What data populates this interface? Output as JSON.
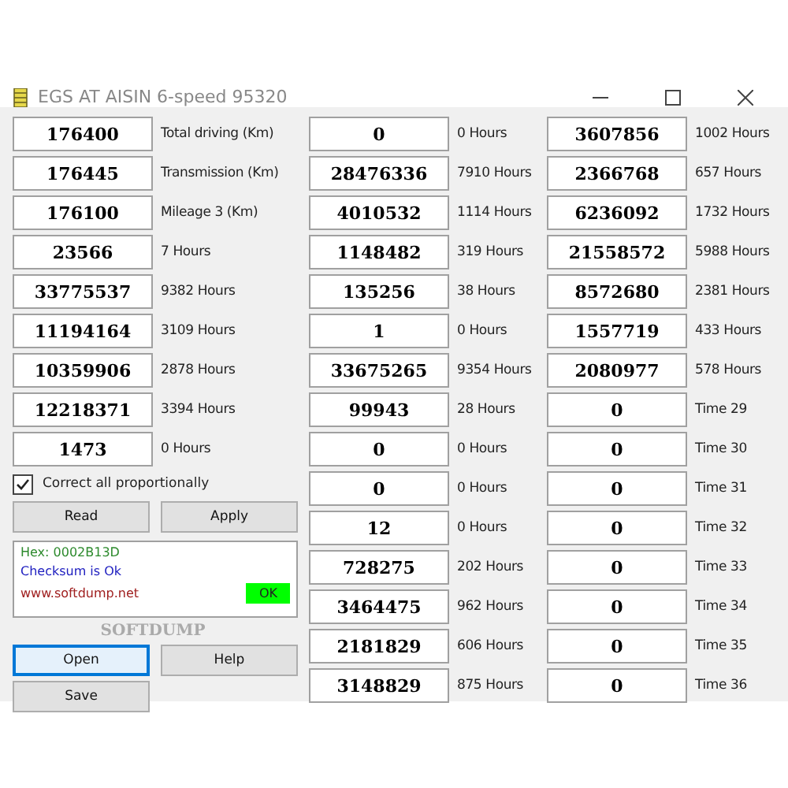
{
  "window": {
    "title": "EGS AT AISIN 6-speed 95320"
  },
  "column_1": [
    {
      "value": "176400",
      "label": "Total driving (Km)"
    },
    {
      "value": "176445",
      "label": "Transmission (Km)"
    },
    {
      "value": "176100",
      "label": "Mileage 3 (Km)"
    },
    {
      "value": "23566",
      "label": "7 Hours"
    },
    {
      "value": "33775537",
      "label": "9382 Hours"
    },
    {
      "value": "11194164",
      "label": "3109 Hours"
    },
    {
      "value": "10359906",
      "label": "2878 Hours"
    },
    {
      "value": "12218371",
      "label": "3394 Hours"
    },
    {
      "value": "1473",
      "label": "0 Hours"
    }
  ],
  "column_2": [
    {
      "value": "0",
      "label": "0 Hours"
    },
    {
      "value": "28476336",
      "label": "7910 Hours"
    },
    {
      "value": "4010532",
      "label": "1114 Hours"
    },
    {
      "value": "1148482",
      "label": "319 Hours"
    },
    {
      "value": "135256",
      "label": "38 Hours"
    },
    {
      "value": "1",
      "label": "0 Hours"
    },
    {
      "value": "33675265",
      "label": "9354 Hours"
    },
    {
      "value": "99943",
      "label": "28 Hours"
    },
    {
      "value": "0",
      "label": "0 Hours"
    },
    {
      "value": "0",
      "label": "0 Hours"
    },
    {
      "value": "12",
      "label": "0 Hours"
    },
    {
      "value": "728275",
      "label": "202 Hours"
    },
    {
      "value": "3464475",
      "label": "962 Hours"
    },
    {
      "value": "2181829",
      "label": "606 Hours"
    },
    {
      "value": "3148829",
      "label": "875 Hours"
    }
  ],
  "column_3": [
    {
      "value": "3607856",
      "label": "1002 Hours"
    },
    {
      "value": "2366768",
      "label": "657 Hours"
    },
    {
      "value": "6236092",
      "label": "1732 Hours"
    },
    {
      "value": "21558572",
      "label": "5988 Hours"
    },
    {
      "value": "8572680",
      "label": "2381 Hours"
    },
    {
      "value": "1557719",
      "label": "433 Hours"
    },
    {
      "value": "2080977",
      "label": "578 Hours"
    },
    {
      "value": "0",
      "label": "Time 29"
    },
    {
      "value": "0",
      "label": "Time 30"
    },
    {
      "value": "0",
      "label": "Time 31"
    },
    {
      "value": "0",
      "label": "Time 32"
    },
    {
      "value": "0",
      "label": "Time 33"
    },
    {
      "value": "0",
      "label": "Time 34"
    },
    {
      "value": "0",
      "label": "Time 35"
    },
    {
      "value": "0",
      "label": "Time 36"
    }
  ],
  "checkbox": {
    "label": "Correct all proportionally",
    "checked": true
  },
  "buttons_top": [
    {
      "label": "Read",
      "focused": false
    },
    {
      "label": "Apply",
      "focused": false
    }
  ],
  "status": {
    "hex": "Hex: 0002B13D",
    "checksum": "Checksum is Ok",
    "url": "www.softdump.net",
    "ok": "OK"
  },
  "brand": "SOFTDUMP",
  "buttons_bottom": [
    {
      "label": "Open",
      "focused": true
    },
    {
      "label": "Help",
      "focused": false
    },
    {
      "label": "Save",
      "focused": false
    }
  ]
}
